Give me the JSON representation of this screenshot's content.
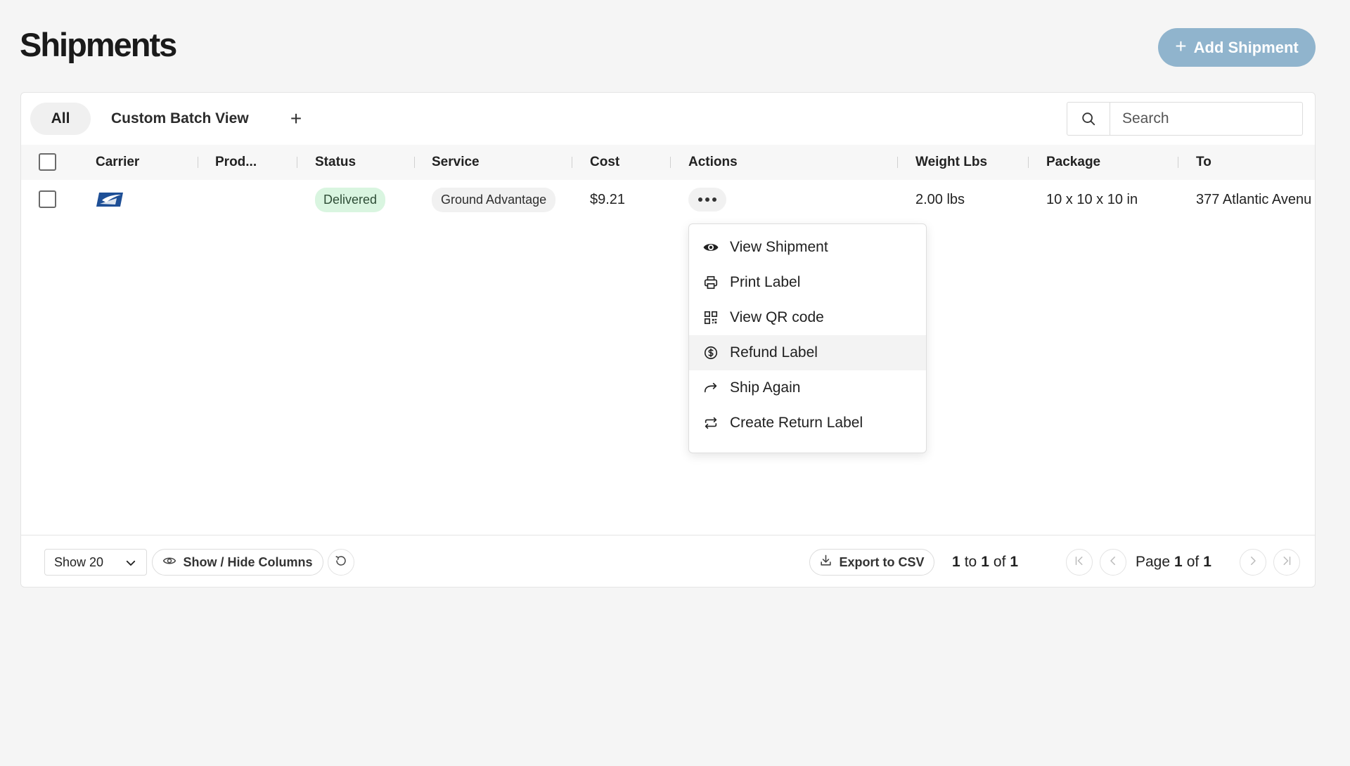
{
  "page": {
    "title": "Shipments"
  },
  "header": {
    "add_button_label": "Add Shipment"
  },
  "tabs": {
    "all": "All",
    "custom": "Custom Batch View",
    "add": "+"
  },
  "search": {
    "placeholder": "Search"
  },
  "table": {
    "columns": [
      "Carrier",
      "Prod...",
      "Status",
      "Service",
      "Cost",
      "Actions",
      "Weight Lbs",
      "Package",
      "To"
    ],
    "rows": [
      {
        "carrier_icon": "usps-eagle-icon",
        "product": "",
        "status": "Delivered",
        "service": "Ground Advantage",
        "cost": "$9.21",
        "weight": "2.00 lbs",
        "package": "10 x 10 x 10 in",
        "to": "377 Atlantic Avenu"
      }
    ]
  },
  "actions_menu": {
    "items": [
      {
        "label": "View Shipment",
        "icon": "eye-icon"
      },
      {
        "label": "Print Label",
        "icon": "printer-icon"
      },
      {
        "label": "View QR code",
        "icon": "qr-code-icon"
      },
      {
        "label": "Refund Label",
        "icon": "dollar-circle-icon",
        "highlighted": true
      },
      {
        "label": "Ship Again",
        "icon": "share-arrow-icon"
      },
      {
        "label": "Create Return Label",
        "icon": "repeat-icon"
      }
    ]
  },
  "footer": {
    "page_size_label": "Show 20",
    "columns_button": "Show / Hide Columns",
    "export_button": "Export to CSV",
    "range": {
      "from": "1",
      "to_word": "to",
      "to": "1",
      "of_word": "of",
      "total": "1"
    },
    "page": {
      "page_word": "Page",
      "current": "1",
      "of_word": "of",
      "total": "1"
    }
  },
  "colors": {
    "accent": "#90b4cd",
    "status_delivered_bg": "#d9f5e0",
    "usps_blue": "#1e4f96"
  }
}
